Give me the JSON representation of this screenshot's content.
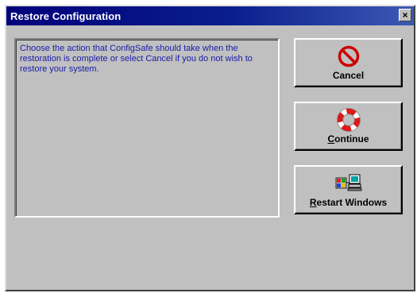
{
  "window": {
    "title": "Restore Configuration",
    "close_glyph": "×"
  },
  "message": {
    "text": "Choose the action that ConfigSafe should take when the restoration is complete or select Cancel if you do not wish to restore your system."
  },
  "buttons": {
    "cancel": {
      "label": "Cancel",
      "icon": "no-entry-icon"
    },
    "continue": {
      "label_first": "C",
      "label_rest": "ontinue",
      "icon": "life-ring-icon"
    },
    "restart": {
      "label_first": "R",
      "label_rest": "estart Windows",
      "icon": "windows-computer-icon"
    }
  },
  "colors": {
    "face": "#c0c0c0",
    "title_bar": "#00007b",
    "message_text": "#1a1aa8",
    "cancel_icon": "#cc0000",
    "life_ring": "#e01818"
  }
}
